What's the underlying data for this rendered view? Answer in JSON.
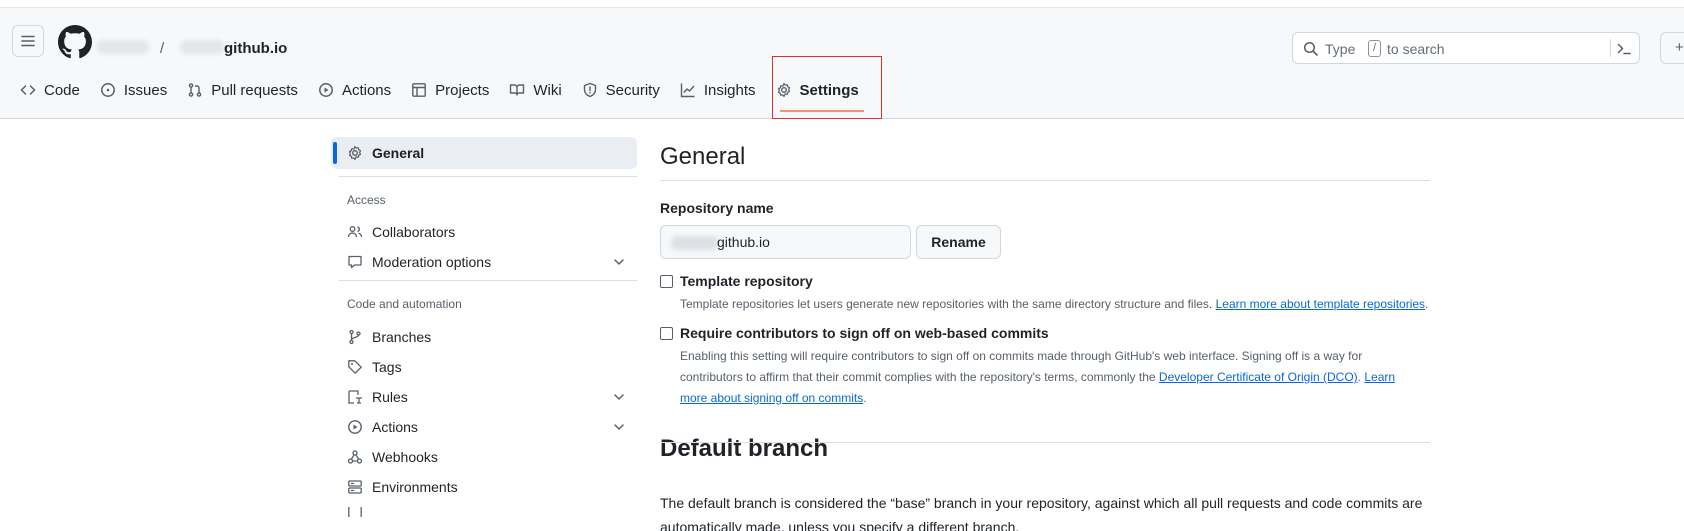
{
  "header": {
    "repo_name": "github.io",
    "separator": "/",
    "search": {
      "prefix": "Type",
      "key": "/",
      "suffix": "to search"
    },
    "edge_button": "+"
  },
  "nav": {
    "tabs": [
      {
        "label": "Code",
        "icon": "code-icon"
      },
      {
        "label": "Issues",
        "icon": "issue-icon"
      },
      {
        "label": "Pull requests",
        "icon": "pull-request-icon"
      },
      {
        "label": "Actions",
        "icon": "play-icon"
      },
      {
        "label": "Projects",
        "icon": "table-icon"
      },
      {
        "label": "Wiki",
        "icon": "book-icon"
      },
      {
        "label": "Security",
        "icon": "shield-icon"
      },
      {
        "label": "Insights",
        "icon": "graph-icon"
      },
      {
        "label": "Settings",
        "icon": "gear-icon",
        "active": true
      }
    ]
  },
  "sidebar": {
    "general": "General",
    "access_heading": "Access",
    "access_items": [
      {
        "label": "Collaborators",
        "icon": "people-icon"
      },
      {
        "label": "Moderation options",
        "icon": "comment-icon",
        "expandable": true
      }
    ],
    "code_heading": "Code and automation",
    "code_items": [
      {
        "label": "Branches",
        "icon": "branch-icon"
      },
      {
        "label": "Tags",
        "icon": "tag-icon"
      },
      {
        "label": "Rules",
        "icon": "rules-icon",
        "expandable": true
      },
      {
        "label": "Actions",
        "icon": "play-icon",
        "expandable": true
      },
      {
        "label": "Webhooks",
        "icon": "webhook-icon"
      },
      {
        "label": "Environments",
        "icon": "server-icon"
      }
    ]
  },
  "main": {
    "title": "General",
    "repo_name_label": "Repository name",
    "repo_name_value": "github.io",
    "rename_button": "Rename",
    "template": {
      "label": "Template repository",
      "description": "Template repositories let users generate new repositories with the same directory structure and files.",
      "link": "Learn more about template repositories",
      "after_link": ".",
      "checked": false
    },
    "signoff": {
      "label": "Require contributors to sign off on web-based commits",
      "line1": "Enabling this setting will require contributors to sign off on commits made through GitHub's web interface. Signing off is a way for",
      "line2_pre": "contributors to affirm that their commit complies with the repository's terms, commonly the",
      "line2_link": "Developer Certificate of Origin (DCO)",
      "line2_post": ".",
      "line2_link2": "Learn",
      "line3_link": "more about signing off on commits",
      "line3_post": ".",
      "checked": false
    },
    "default_branch_title": "Default branch",
    "default_branch_text_1": "The default branch is considered the “base” branch in your repository, against which all pull requests and code commits are",
    "default_branch_text_2": "automatically made, unless you specify a different branch."
  },
  "colors": {
    "accent": "#0969da",
    "active_underline": "#fd8c73",
    "highlight_box": "#e03131"
  }
}
